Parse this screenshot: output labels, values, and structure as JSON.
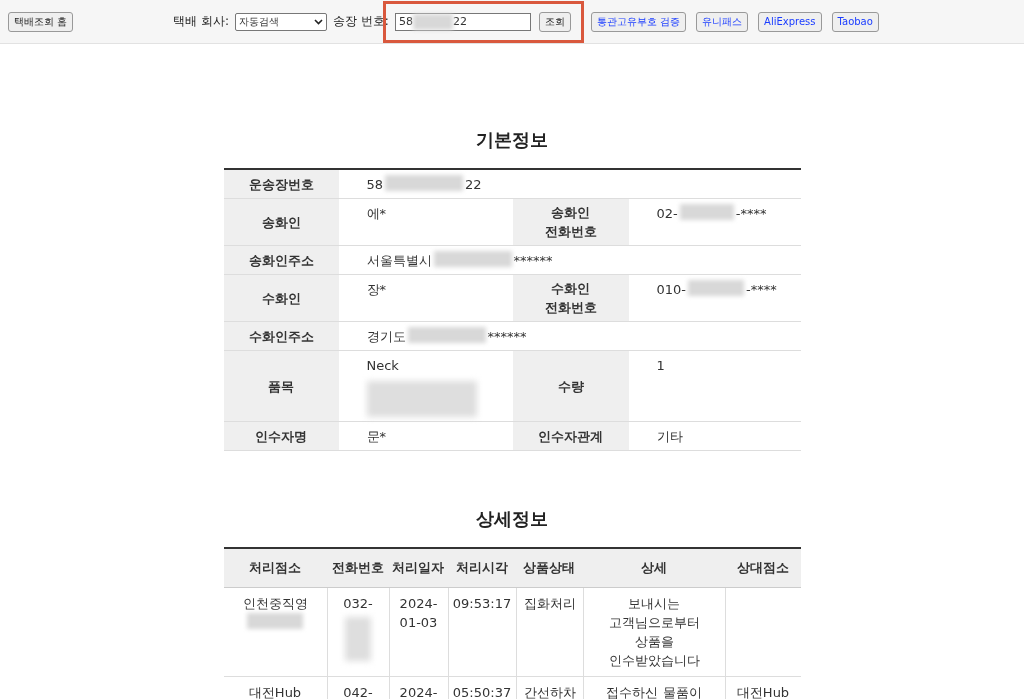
{
  "toolbar": {
    "home_button": "택배조회 홈",
    "company_label": "택배 회사:",
    "company_select": "자동검색",
    "tracking_label": "송장 번호:",
    "tracking_value": [
      {
        "kind": "text",
        "text": "58"
      },
      {
        "kind": "blur"
      },
      {
        "kind": "text",
        "text": "22"
      }
    ],
    "highlight": true,
    "search_button": "조회",
    "links": [
      "통관고유부호 검증",
      "유니패스",
      "AliExpress",
      "Taobao"
    ]
  },
  "basic_info": {
    "title": "기본정보",
    "rows": [
      {
        "kind": "wide",
        "label": "운송장번호",
        "value": [
          {
            "kind": "text",
            "text": "58"
          },
          {
            "kind": "blur"
          },
          {
            "kind": "text",
            "text": "22"
          }
        ]
      },
      {
        "kind": "pair",
        "label": "송화인",
        "value": [
          {
            "kind": "text",
            "text": "에*"
          }
        ],
        "label2": "송화인\n전화번호",
        "value2": [
          {
            "kind": "text",
            "text": "02-"
          },
          {
            "kind": "blur"
          },
          {
            "kind": "text",
            "text": "-****"
          }
        ]
      },
      {
        "kind": "wide",
        "label": "송화인주소",
        "value": [
          {
            "kind": "text",
            "text": "서울특별시"
          },
          {
            "kind": "blur"
          },
          {
            "kind": "text",
            "text": "******"
          }
        ]
      },
      {
        "kind": "pair",
        "label": "수화인",
        "value": [
          {
            "kind": "text",
            "text": "장*"
          }
        ],
        "label2": "수화인\n전화번호",
        "value2": [
          {
            "kind": "text",
            "text": "010-"
          },
          {
            "kind": "blur"
          },
          {
            "kind": "text",
            "text": "-****"
          }
        ]
      },
      {
        "kind": "wide",
        "label": "수화인주소",
        "value": [
          {
            "kind": "text",
            "text": "경기도"
          },
          {
            "kind": "blur"
          },
          {
            "kind": "text",
            "text": "******"
          }
        ]
      },
      {
        "kind": "pair",
        "label": "품목",
        "value": [
          {
            "kind": "text",
            "text": "Neck"
          },
          {
            "kind": "blurblock"
          }
        ],
        "label2": "수량",
        "value2": [
          {
            "kind": "text",
            "text": "1"
          }
        ]
      },
      {
        "kind": "pair",
        "label": "인수자명",
        "value": [
          {
            "kind": "text",
            "text": "문*"
          }
        ],
        "label2": "인수자관계",
        "value2": [
          {
            "kind": "text",
            "text": "기타"
          }
        ]
      }
    ]
  },
  "detail_info": {
    "title": "상세정보",
    "columns": [
      "처리점소",
      "전화번호",
      "처리일자",
      "처리시각",
      "상품상태",
      "상세",
      "상대점소"
    ],
    "rows": [
      {
        "cells": [
          [
            {
              "kind": "text",
              "text": "인천중직영"
            },
            {
              "kind": "paren-blur"
            }
          ],
          [
            {
              "kind": "text",
              "text": "032-"
            },
            {
              "kind": "blurblock"
            }
          ],
          [
            {
              "kind": "text",
              "text": "2024-\n01-03"
            }
          ],
          [
            {
              "kind": "text",
              "text": "09:53:17"
            }
          ],
          [
            {
              "kind": "text",
              "text": "집화처리"
            }
          ],
          [
            {
              "kind": "text",
              "text": "보내시는\n고객님으로부터\n상품을\n인수받았습니다"
            }
          ],
          []
        ]
      },
      {
        "cells": [
          [
            {
              "kind": "text",
              "text": "대전Hub"
            }
          ],
          [
            {
              "kind": "text",
              "text": "042-"
            }
          ],
          [
            {
              "kind": "text",
              "text": "2024-"
            }
          ],
          [
            {
              "kind": "text",
              "text": "05:50:37"
            }
          ],
          [
            {
              "kind": "text",
              "text": "간선하차"
            }
          ],
          [
            {
              "kind": "text",
              "text": "접수하신 물품이"
            }
          ],
          [
            {
              "kind": "text",
              "text": "대전Hub"
            }
          ]
        ]
      }
    ]
  }
}
